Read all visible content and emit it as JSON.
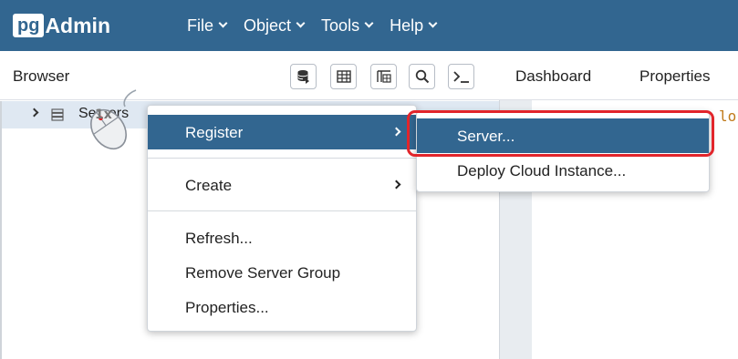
{
  "app": {
    "logo_prefix": "pg",
    "logo_name": "Admin"
  },
  "menubar": {
    "items": [
      {
        "label": "File"
      },
      {
        "label": "Object"
      },
      {
        "label": "Tools"
      },
      {
        "label": "Help"
      }
    ]
  },
  "browser": {
    "title": "Browser",
    "toolbar_icons": [
      "database-query-icon",
      "table-grid-icon",
      "table-filter-icon",
      "search-icon",
      "terminal-icon"
    ]
  },
  "tree": {
    "node_label": "Servers"
  },
  "tabs": [
    {
      "label": "Dashboard"
    },
    {
      "label": "Properties"
    }
  ],
  "dashboard_snippet": "lo",
  "context_menu": {
    "items": [
      {
        "label": "Register",
        "has_submenu": true,
        "active": true
      },
      {
        "label": "Create",
        "has_submenu": true,
        "active": false
      },
      {
        "label": "Refresh...",
        "has_submenu": false,
        "active": false
      },
      {
        "label": "Remove Server Group",
        "has_submenu": false,
        "active": false
      },
      {
        "label": "Properties...",
        "has_submenu": false,
        "active": false
      }
    ]
  },
  "submenu": {
    "items": [
      {
        "label": "Server...",
        "active": true
      },
      {
        "label": "Deploy Cloud Instance...",
        "active": false
      }
    ]
  },
  "annotation": {
    "click_count": "1x"
  },
  "colors": {
    "brand": "#326690",
    "highlight": "#e2252b",
    "tree_selection": "#dfe8f2"
  }
}
